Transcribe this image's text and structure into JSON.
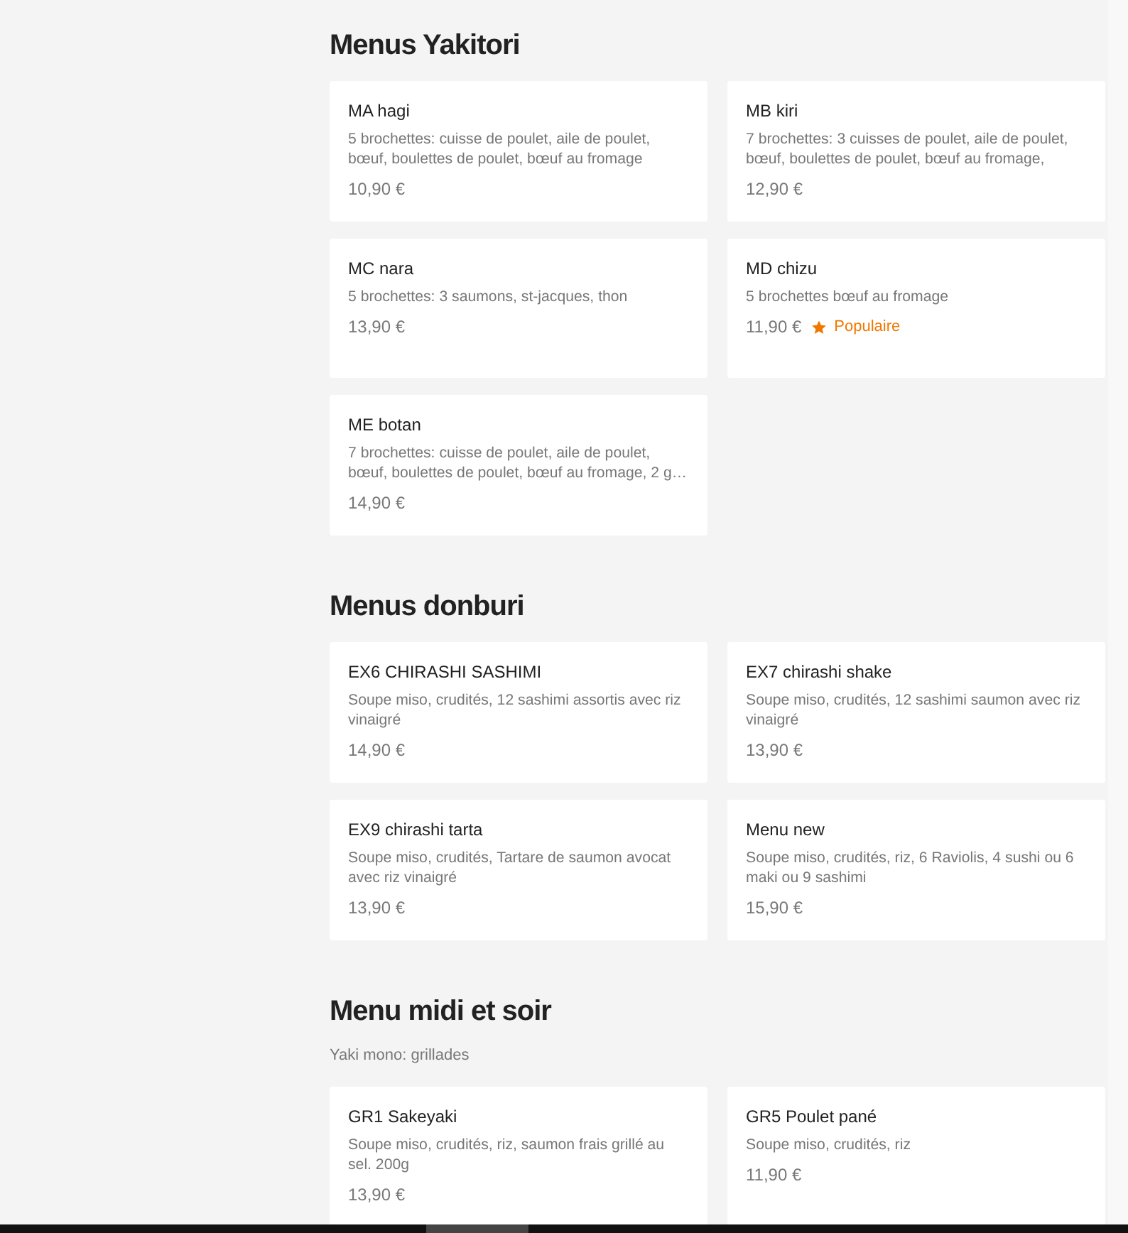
{
  "sections": [
    {
      "title": "Menus Yakitori",
      "items": [
        {
          "kind": "dish",
          "name": "MA hagi",
          "description": "5 brochettes: cuisse de poulet, aile de poulet, bœuf, boulettes de poulet, bœuf au fromage",
          "price": "10,90 €"
        },
        {
          "kind": "dish",
          "name": "MB kiri",
          "description": "7 brochettes: 3 cuisses de poulet, aile de poulet, bœuf, boulettes de poulet, bœuf au fromage,",
          "price": "12,90 €"
        },
        {
          "kind": "dish",
          "name": "MC nara",
          "description": "5 brochettes: 3 saumons, st-jacques, thon",
          "price": "13,90 €"
        },
        {
          "kind": "dish",
          "name": "MD chizu",
          "description": "5 brochettes bœuf au fromage",
          "price": "11,90 €",
          "badge": "Populaire"
        },
        {
          "kind": "dish",
          "name": "ME botan",
          "description": "7 brochettes: cuisse de poulet, aile de poulet, bœuf, boulettes de poulet, bœuf au fromage, 2 g…",
          "price": "14,90 €"
        }
      ]
    },
    {
      "title": "Menus donburi",
      "items": [
        {
          "kind": "dish",
          "name": "EX6 CHIRASHI SASHIMI",
          "description": "Soupe miso, crudités, 12 sashimi assortis avec riz vinaigré",
          "price": "14,90 €"
        },
        {
          "kind": "dish",
          "name": "EX7 chirashi shake",
          "description": "Soupe miso, crudités, 12 sashimi saumon avec riz vinaigré",
          "price": "13,90 €"
        },
        {
          "kind": "dish",
          "name": "EX9 chirashi tarta",
          "description": "Soupe miso, crudités, Tartare de saumon avocat avec riz vinaigré",
          "price": "13,90 €"
        },
        {
          "kind": "dish",
          "name": "Menu new",
          "description": "Soupe miso, crudités, riz, 6 Raviolis, 4 sushi ou 6 maki ou 9 sashimi",
          "price": "15,90 €"
        }
      ]
    },
    {
      "title": "Menu midi et soir",
      "subtitle": "Yaki mono: grillades",
      "items": [
        {
          "kind": "dish",
          "name": "GR1 Sakeyaki",
          "description": "Soupe miso, crudités, riz, saumon frais grillé au sel. 200g",
          "price": "13,90 €"
        },
        {
          "kind": "dish",
          "name": "GR5 Poulet pané",
          "description": "Soupe miso, crudités, riz",
          "price": "11,90 €"
        }
      ]
    }
  ]
}
